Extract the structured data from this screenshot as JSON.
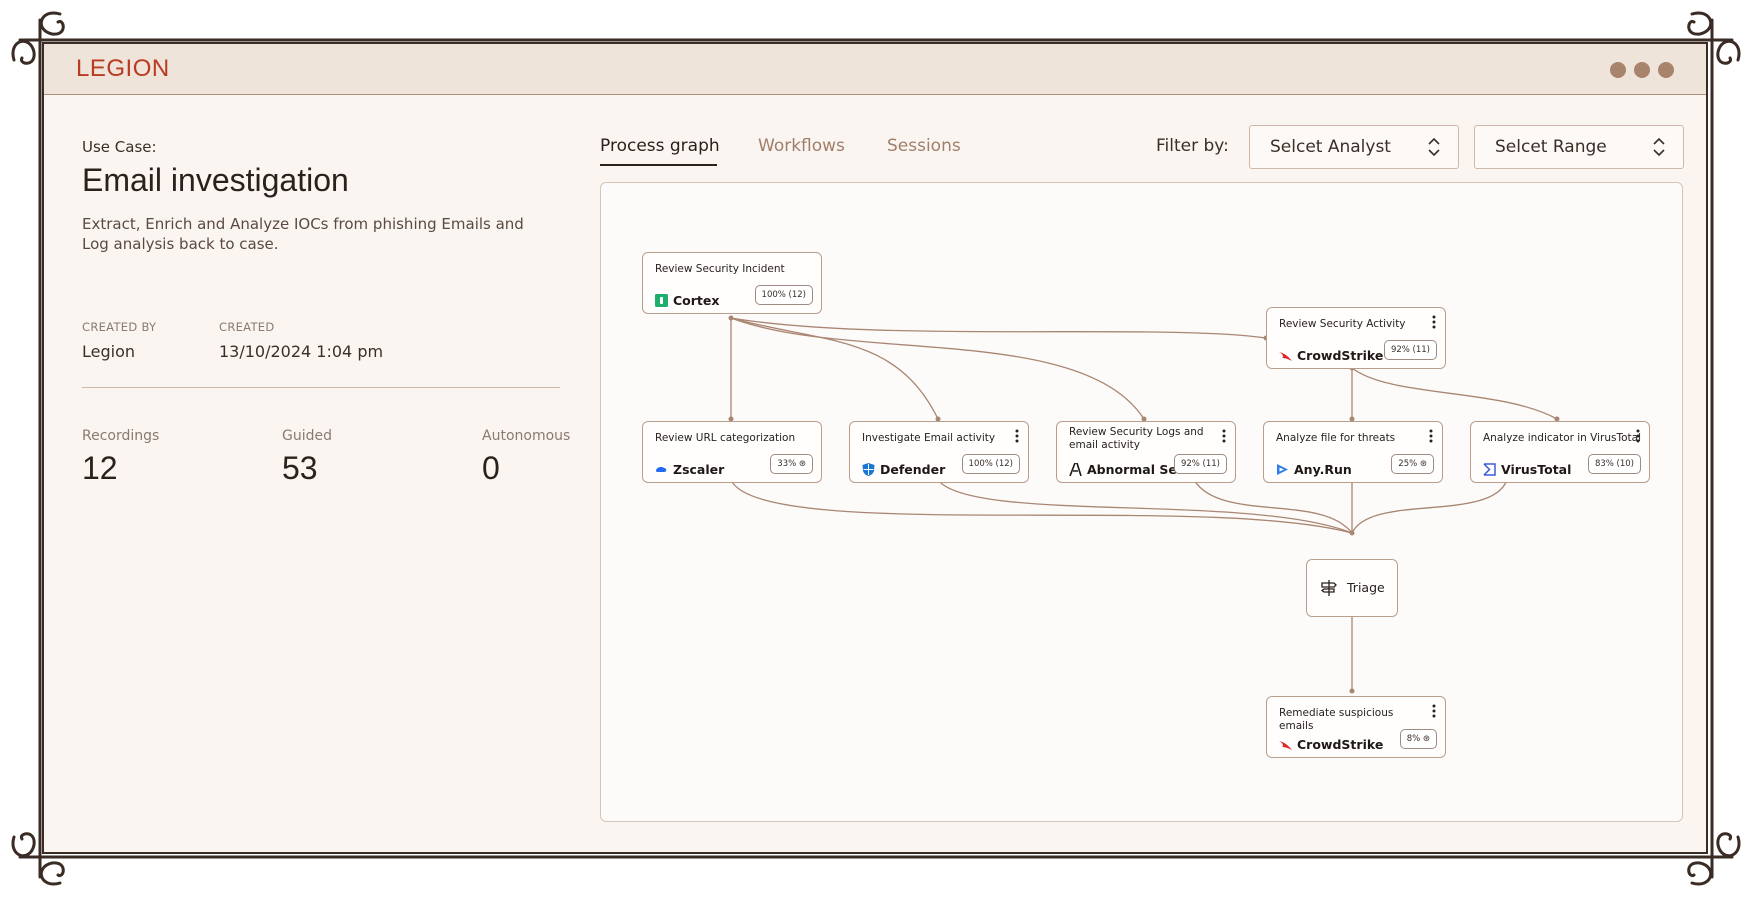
{
  "app": {
    "logo": "LEGION"
  },
  "colors": {
    "accent": "#bb3a22",
    "edge": "#a98672",
    "background": "#fbf5f1"
  },
  "usecase": {
    "label": "Use Case:",
    "title": "Email investigation",
    "description": "Extract, Enrich and Analyze IOCs from phishing Emails and Log analysis back to case."
  },
  "meta": {
    "created_by_label": "CREATED BY",
    "created_by": "Legion",
    "created_label": "CREATED",
    "created": "13/10/2024 1:04 pm"
  },
  "stats": [
    {
      "label": "Recordings",
      "value": "12"
    },
    {
      "label": "Guided",
      "value": "53"
    },
    {
      "label": "Autonomous",
      "value": "0"
    }
  ],
  "tabs": [
    {
      "label": "Process graph",
      "active": true
    },
    {
      "label": "Workflows",
      "active": false
    },
    {
      "label": "Sessions",
      "active": false
    }
  ],
  "filter": {
    "label": "Filter by:",
    "analyst": "Selcet Analyst",
    "range": "Selcet Range"
  },
  "graph": {
    "nodes": {
      "review_incident": {
        "title": "Review Security Incident",
        "tool": "Cortex",
        "badge": "100% (12)",
        "icon": "cortex-icon"
      },
      "review_activity": {
        "title": "Review Security Activity",
        "tool": "CrowdStrike",
        "badge": "92% (11)",
        "icon": "crowdstrike-icon"
      },
      "review_url": {
        "title": "Review URL categorization",
        "tool": "Zscaler",
        "badge": "33% ⊛",
        "icon": "zscaler-icon"
      },
      "investigate_email": {
        "title": "Investigate Email activity",
        "tool": "Defender",
        "badge": "100% (12)",
        "icon": "defender-icon"
      },
      "review_logs": {
        "title": "Review Security Logs and email activity",
        "tool": "Abnormal Sec..",
        "badge": "92% (11)",
        "icon": "abnormal-icon"
      },
      "analyze_file": {
        "title": "Analyze file for threats",
        "tool": "Any.Run",
        "badge": "25% ⊛",
        "icon": "anyrun-icon"
      },
      "analyze_indicator": {
        "title": "Analyze indicator in VirusTotal",
        "tool": "VirusTotal",
        "badge": "83% (10)",
        "icon": "virustotal-icon"
      },
      "triage": {
        "title": "Triage",
        "icon": "signpost-icon"
      },
      "remediate": {
        "title": "Remediate suspicious emails",
        "tool": "CrowdStrike",
        "badge": "8% ⊛",
        "icon": "crowdstrike-icon"
      }
    }
  }
}
